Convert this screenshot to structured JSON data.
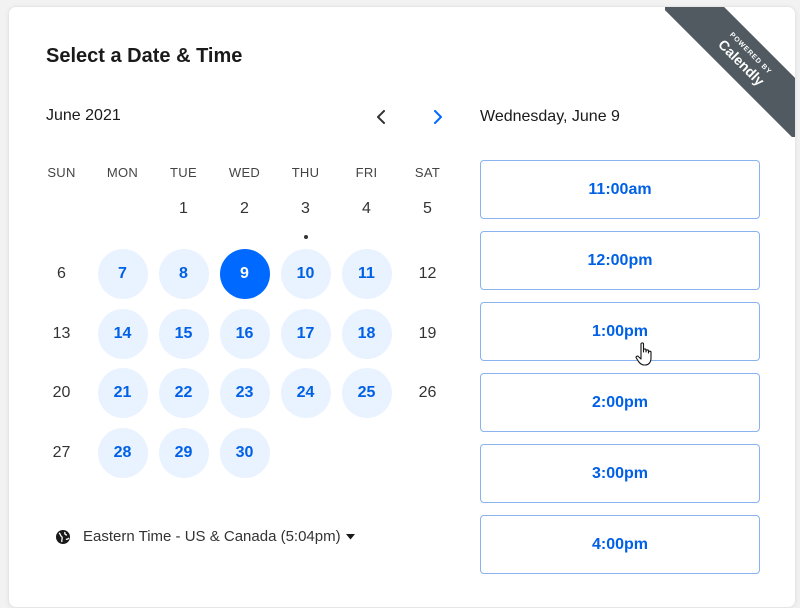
{
  "title": "Select a Date & Time",
  "ribbon": {
    "small": "POWERED BY",
    "big": "Calendly"
  },
  "calendar": {
    "month_label": "June 2021",
    "weekdays": [
      "SUN",
      "MON",
      "TUE",
      "WED",
      "THU",
      "FRI",
      "SAT"
    ],
    "weeks": [
      [
        null,
        null,
        "1",
        "2",
        "3",
        "4",
        "5"
      ],
      [
        "6",
        "7",
        "8",
        "9",
        "10",
        "11",
        "12"
      ],
      [
        "13",
        "14",
        "15",
        "16",
        "17",
        "18",
        "19"
      ],
      [
        "20",
        "21",
        "22",
        "23",
        "24",
        "25",
        "26"
      ],
      [
        "27",
        "28",
        "29",
        "30",
        null,
        null,
        null
      ]
    ],
    "available": [
      "7",
      "8",
      "10",
      "11",
      "14",
      "15",
      "16",
      "17",
      "18",
      "21",
      "22",
      "23",
      "24",
      "25",
      "28",
      "29",
      "30"
    ],
    "selected": "9",
    "today": "3"
  },
  "timezone": {
    "label": "Eastern Time - US & Canada (5:04pm)"
  },
  "schedule": {
    "date_heading": "Wednesday, June 9",
    "slots": [
      "11:00am",
      "12:00pm",
      "1:00pm",
      "2:00pm",
      "3:00pm",
      "4:00pm"
    ]
  },
  "colors": {
    "accent": "#0069ff",
    "available_bg": "#e9f2ff",
    "ribbon_bg": "#505a60"
  }
}
